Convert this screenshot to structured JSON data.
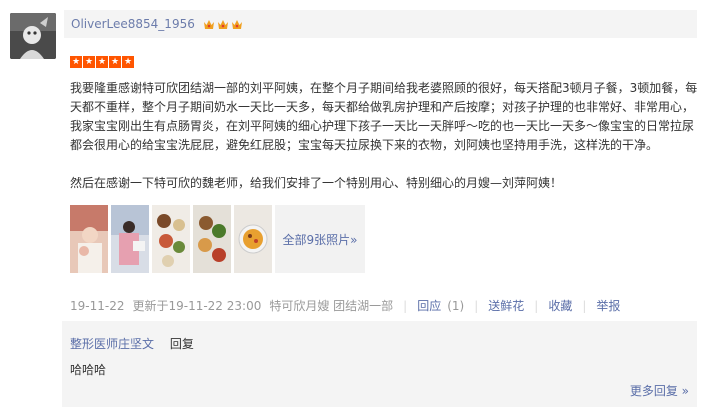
{
  "user": {
    "name": "OliverLee8854_1956",
    "badge_icons": [
      "crown-icon",
      "crown-icon",
      "crown-icon"
    ],
    "badge_color": "#f0a020"
  },
  "rating": {
    "stars": 5,
    "max": 5,
    "color": "#ff5500"
  },
  "review": {
    "paragraph1": "我要隆重感谢特可欣团结湖一部的刘平阿姨，在整个月子期间给我老婆照顾的很好，每天搭配3顿月子餐，3顿加餐，每天都不重样，整个月子期间奶水一天比一天多，每天都给做乳房护理和产后按摩；对孩子护理的也非常好、非常用心，我家宝宝刚出生有点肠胃炎，在刘平阿姨的细心护理下孩子一天比一天胖呼～吃的也一天比一天多～像宝宝的日常拉尿都会很用心的给宝宝洗屁屁，避免红屁股；宝宝每天拉尿换下来的衣物，刘阿姨也坚持用手洗，这样洗的干净。",
    "paragraph2": "然后在感谢一下特可欣的魏老师，给我们安排了一个特别用心、特别细心的月嫂—刘萍阿姨！"
  },
  "photos": {
    "thumbnails": [
      "photo-1",
      "photo-2",
      "photo-3",
      "photo-4",
      "photo-5"
    ],
    "all_label": "全部9张照片»"
  },
  "meta": {
    "date": "19-11-22",
    "updated": "更新于19-11-22 23:00",
    "shop": "特可欣月嫂 团结湖一部",
    "reply_label": "回应",
    "reply_count": "(1)",
    "flower_label": "送鲜花",
    "collect_label": "收藏",
    "report_label": "举报"
  },
  "reply": {
    "author": "整形医师庄坚文",
    "action": "回复",
    "content": "哈哈哈",
    "more_label": "更多回复 »"
  },
  "colors": {
    "link": "#5a6ea8",
    "username": "#6c7cab",
    "muted": "#999999",
    "panel": "#f4f4f4"
  }
}
